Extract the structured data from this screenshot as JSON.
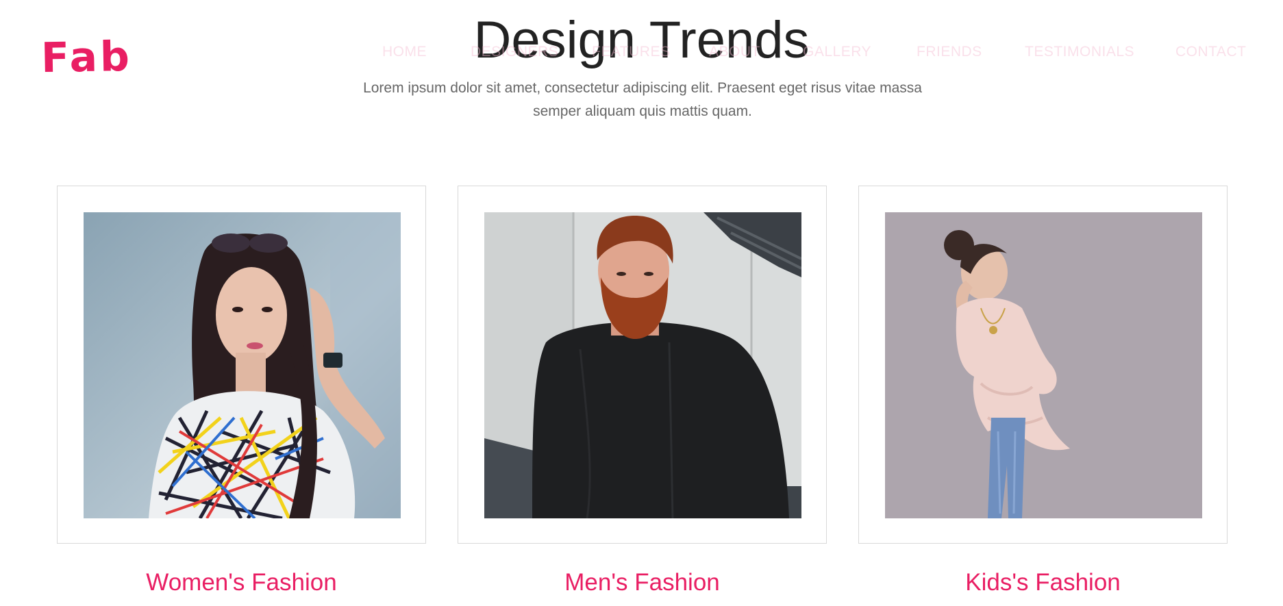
{
  "brand": {
    "logo_text": "Fab",
    "accent_color": "#e91e63"
  },
  "nav": {
    "items": [
      {
        "label": "HOME"
      },
      {
        "label": "DESIGNERS"
      },
      {
        "label": "FEATURES"
      },
      {
        "label": "ABOUT"
      },
      {
        "label": "GALLERY"
      },
      {
        "label": "FRIENDS"
      },
      {
        "label": "TESTIMONIALS"
      },
      {
        "label": "CONTACT"
      }
    ]
  },
  "section": {
    "title": "Design Trends",
    "subtitle": "Lorem ipsum dolor sit amet, consectetur adipiscing elit. Praesent eget risus vitae massa semper aliquam quis mattis quam."
  },
  "cards": [
    {
      "title": "Women's Fashion",
      "image_icon": "woman-portrait-photo"
    },
    {
      "title": "Men's Fashion",
      "image_icon": "man-portrait-photo"
    },
    {
      "title": "Kids's Fashion",
      "image_icon": "girl-portrait-photo"
    }
  ]
}
